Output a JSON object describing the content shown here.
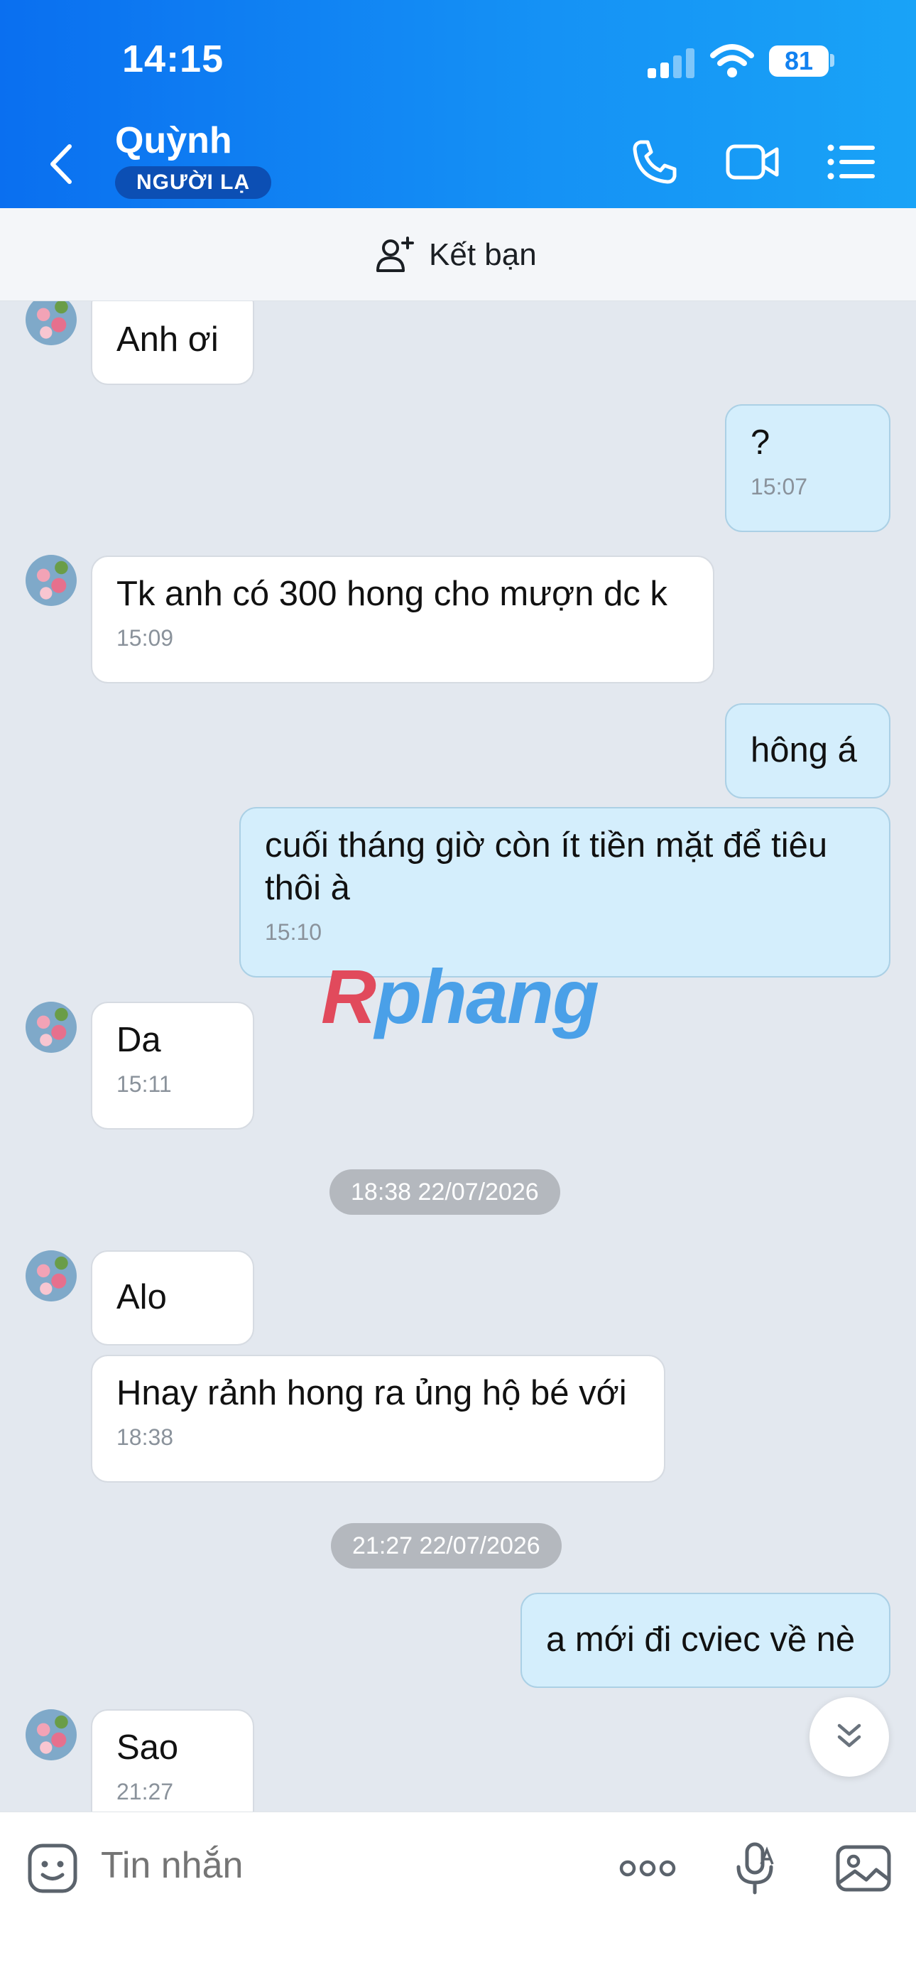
{
  "status_bar": {
    "time": "14:15",
    "battery": "81"
  },
  "header": {
    "contact_name": "Quỳnh",
    "badge": "NGƯỜI LẠ"
  },
  "add_friend": {
    "label": "Kết bạn"
  },
  "messages": [
    {
      "dir": "in",
      "text": "Anh ơi"
    },
    {
      "dir": "out",
      "text": "?",
      "time": "15:07"
    },
    {
      "dir": "in",
      "text": "Tk anh có 300 hong cho mượn dc k",
      "time": "15:09"
    },
    {
      "dir": "out",
      "text": "hông á"
    },
    {
      "dir": "out",
      "text": "cuối tháng giờ còn ít tiền mặt để tiêu thôi à",
      "time": "15:10"
    },
    {
      "dir": "in",
      "text": "Da",
      "time": "15:11"
    },
    {
      "dir": "in",
      "text": "Alo"
    },
    {
      "dir": "in",
      "text": "Hnay rảnh hong ra ủng hộ bé với",
      "time": "18:38"
    },
    {
      "dir": "out",
      "text": "a mới đi cviec về nè"
    },
    {
      "dir": "in",
      "text": "Sao",
      "time": "21:27"
    }
  ],
  "date_separators": [
    "18:38 22/07/2026",
    "21:27 22/07/2026"
  ],
  "watermark": {
    "r": "R",
    "rest": "phang"
  },
  "composer": {
    "placeholder": "Tin nhắn"
  },
  "icons": [
    "back-icon",
    "phone-icon",
    "video-call-icon",
    "menu-list-icon",
    "add-friend-icon",
    "chevrons-down-icon",
    "sticker-icon",
    "more-dots-icon",
    "voice-to-text-icon",
    "image-icon"
  ]
}
